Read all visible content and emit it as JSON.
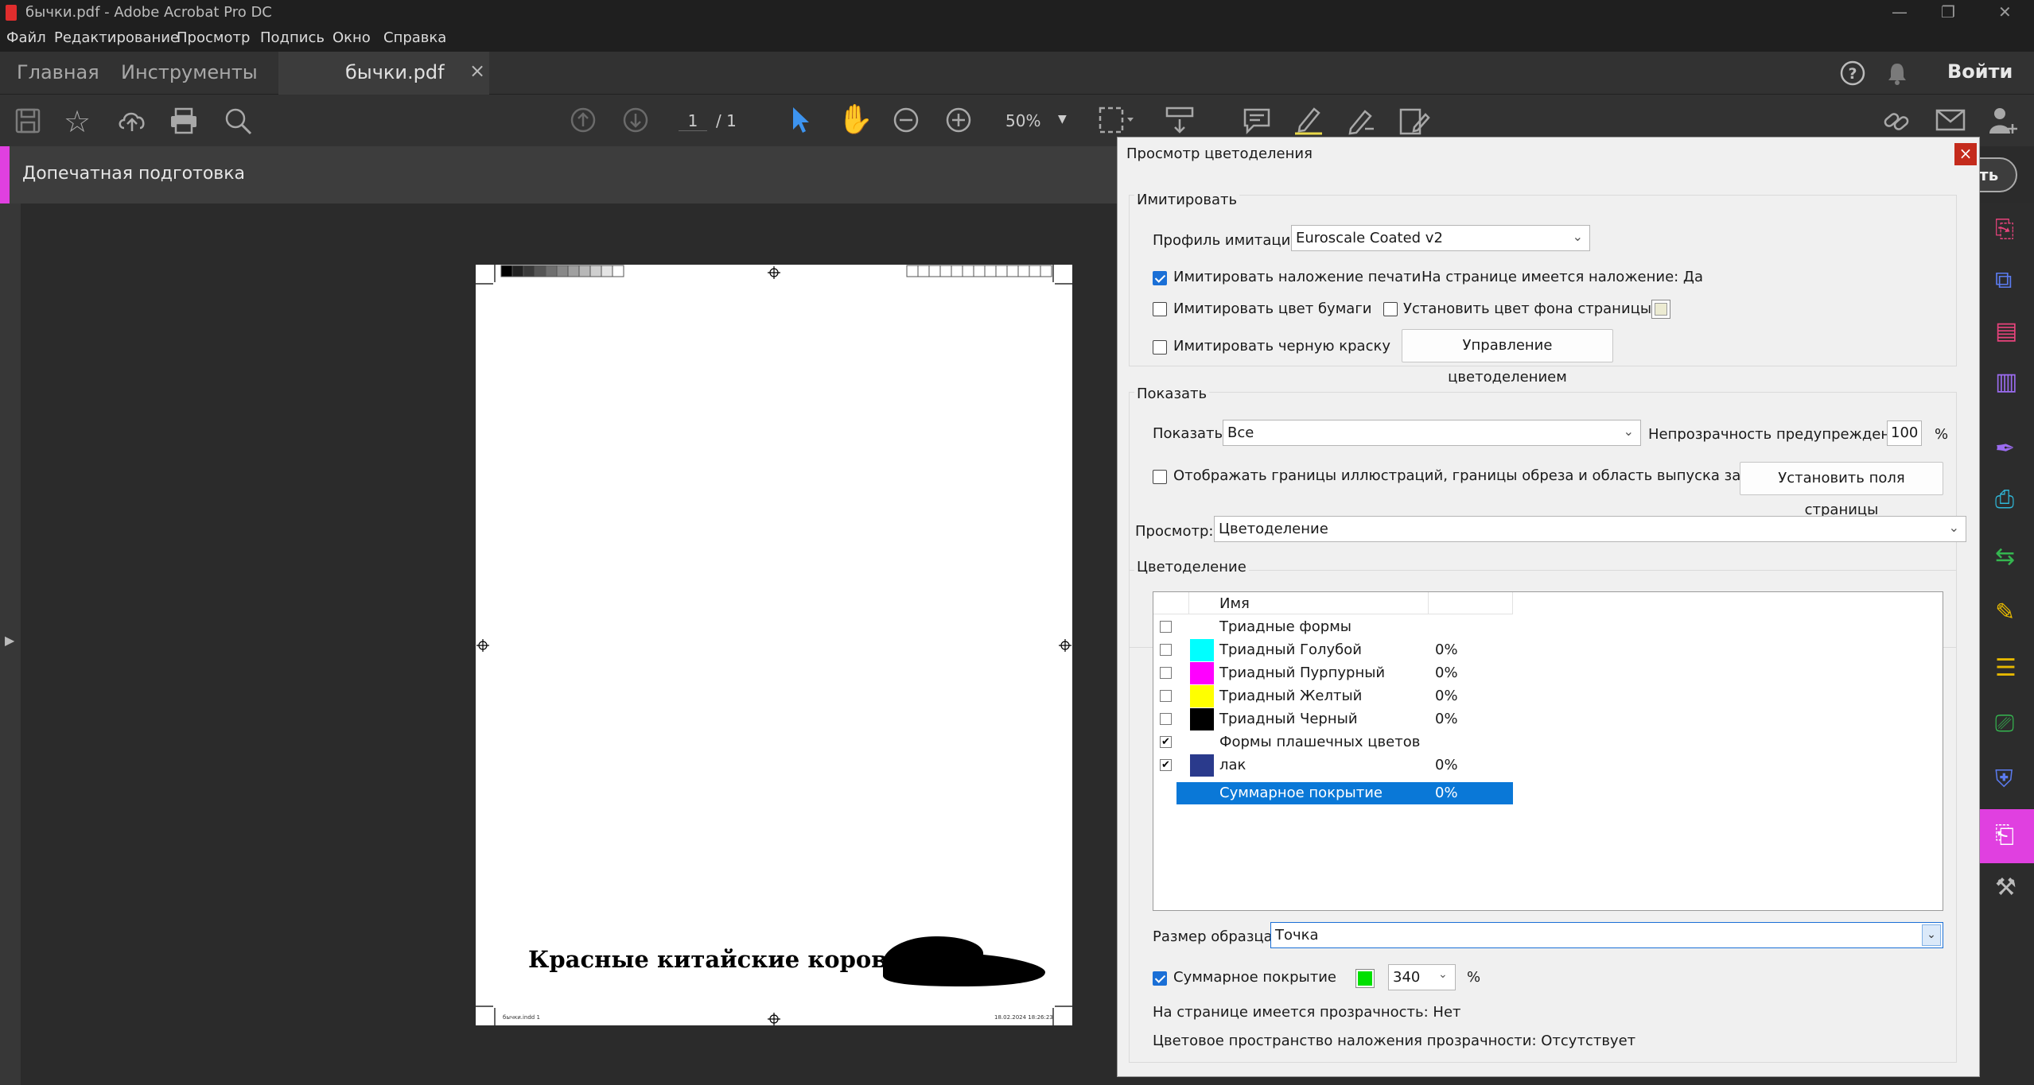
{
  "window": {
    "title": "бычки.pdf - Adobe Acrobat Pro DC",
    "minimize": "—",
    "restore": "❐",
    "close": "✕"
  },
  "menu": [
    "Файл",
    "Редактирование",
    "Просмотр",
    "Подпись",
    "Окно",
    "Справка"
  ],
  "tabs": {
    "home": "Главная",
    "tools": "Инструменты",
    "document": "бычки.pdf",
    "close": "×",
    "signin": "Войти"
  },
  "toolbar": {
    "page_current": "1",
    "page_total": "/ 1",
    "zoom": "50%"
  },
  "tool_panel": {
    "title": "Допечатная подготовка",
    "action_fragment": "ть"
  },
  "page": {
    "headline": "Красные китайские коровы",
    "footer_left": "бычки.indd 1",
    "footer_right": "18.02.2024 18:26:23"
  },
  "dialog": {
    "title": "Просмотр цветоделения",
    "close": "×",
    "simulate": {
      "legend": "Имитировать",
      "profile_label": "Профиль имитации:",
      "profile_value": "Euroscale Coated v2",
      "overprint_label": "Имитировать наложение печати",
      "overprint_checked": true,
      "overprint_status": "На странице имеется наложение:  Да",
      "paper_label": "Имитировать цвет бумаги",
      "bg_label": "Установить цвет фона страницы",
      "black_label": "Имитировать черную краску",
      "manage_button": "Управление цветоделением"
    },
    "show": {
      "legend": "Показать",
      "show_label": "Показать:",
      "show_value": "Все",
      "opacity_label": "Непрозрачность предупреждений:",
      "opacity_value": "100",
      "percent": "%",
      "boxes_label": "Отображать границы иллюстраций, границы обреза и область выпуска за обрез",
      "set_boxes_button": "Установить поля страницы"
    },
    "preview": {
      "label": "Просмотр:",
      "value": "Цветоделение"
    },
    "separations": {
      "legend": "Цветоделение",
      "col_name": "Имя",
      "rows": [
        {
          "checked": false,
          "color": "",
          "name": "Триадные формы",
          "value": ""
        },
        {
          "checked": false,
          "color": "#00ffff",
          "name": "Триадный Голубой",
          "value": "0%"
        },
        {
          "checked": false,
          "color": "#ff00ff",
          "name": "Триадный Пурпурный",
          "value": "0%"
        },
        {
          "checked": false,
          "color": "#ffff00",
          "name": "Триадный Желтый",
          "value": "0%"
        },
        {
          "checked": false,
          "color": "#000000",
          "name": "Триадный Черный",
          "value": "0%"
        },
        {
          "checked": true,
          "color": "",
          "name": "Формы плашечных цветов",
          "value": ""
        },
        {
          "checked": true,
          "color": "#2a3a8c",
          "name": "лак",
          "value": "0%"
        }
      ],
      "total_name": "Суммарное покрытие",
      "total_value": "0%"
    },
    "sample": {
      "label": "Размер образца:",
      "value": "Точка"
    },
    "coverage": {
      "label": "Суммарное покрытие",
      "checked": true,
      "color": "#00e000",
      "value": "340",
      "percent": "%"
    },
    "transparency": "На странице имеется прозрачность:  Нет",
    "blend_space": "Цветовое пространство наложения прозрачности:  Отсутствует"
  },
  "colors": {
    "accent": "#1a6fd6",
    "tool_accent": "#e040e0",
    "highlight": "#0a78d7"
  }
}
